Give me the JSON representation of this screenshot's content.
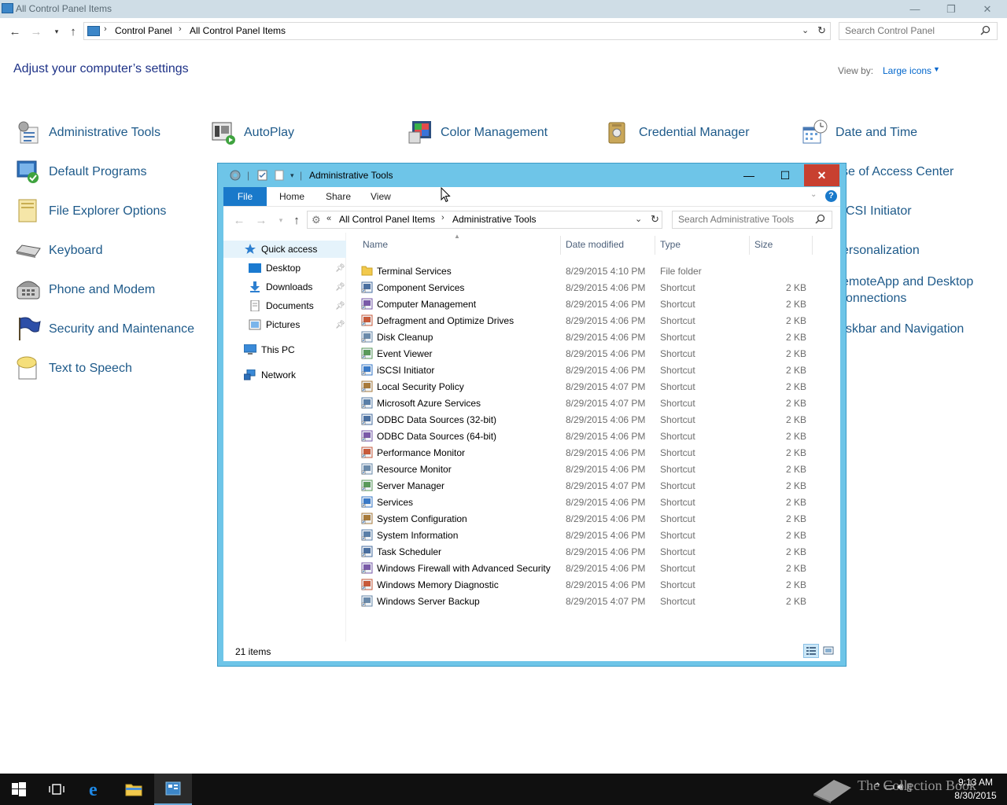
{
  "control_panel": {
    "window_title": "All Control Panel Items",
    "address": {
      "crumbs": [
        "Control Panel",
        "All Control Panel Items"
      ]
    },
    "search_placeholder": "Search Control Panel",
    "heading": "Adjust your computer’s settings",
    "view_by_label": "View by:",
    "view_by_value": "Large icons",
    "items": [
      {
        "label": "Administrative Tools",
        "icon": "admin-tools-icon"
      },
      {
        "label": "AutoPlay",
        "icon": "autoplay-icon"
      },
      {
        "label": "Color Management",
        "icon": "color-management-icon"
      },
      {
        "label": "Credential Manager",
        "icon": "credential-manager-icon"
      },
      {
        "label": "Date and Time",
        "icon": "date-time-icon"
      },
      {
        "label": "Default Programs",
        "icon": "default-programs-icon"
      },
      {
        "label": "se of Access Center",
        "icon": "ease-of-access-icon"
      },
      {
        "label": "File Explorer Options",
        "icon": "file-explorer-options-icon"
      },
      {
        "label": "CSI Initiator",
        "icon": "iscsi-icon"
      },
      {
        "label": "Keyboard",
        "icon": "keyboard-icon"
      },
      {
        "label": "ersonalization",
        "icon": "personalization-icon"
      },
      {
        "label": "Phone and Modem",
        "icon": "phone-modem-icon"
      },
      {
        "label": "emoteApp and Desktop",
        "label2": "onnections",
        "icon": "remoteapp-icon"
      },
      {
        "label": "Security and Maintenance",
        "icon": "security-maintenance-icon"
      },
      {
        "label": "skbar and Navigation",
        "icon": "taskbar-icon"
      },
      {
        "label": "Text to Speech",
        "icon": "text-to-speech-icon"
      }
    ]
  },
  "admin_tools": {
    "window_title": "Administrative Tools",
    "ribbon_tabs": [
      "File",
      "Home",
      "Share",
      "View"
    ],
    "address": {
      "prefix": "«",
      "crumbs": [
        "All Control Panel Items",
        "Administrative Tools"
      ]
    },
    "search_placeholder": "Search Administrative Tools",
    "nav_tree": [
      {
        "label": "Quick access",
        "icon": "star-icon",
        "pinned": false
      },
      {
        "label": "Desktop",
        "icon": "desktop-icon",
        "pinned": true
      },
      {
        "label": "Downloads",
        "icon": "download-icon",
        "pinned": true
      },
      {
        "label": "Documents",
        "icon": "documents-icon",
        "pinned": true
      },
      {
        "label": "Pictures",
        "icon": "pictures-icon",
        "pinned": true
      },
      {
        "label": "This PC",
        "icon": "computer-icon",
        "pinned": false
      },
      {
        "label": "Network",
        "icon": "network-icon",
        "pinned": false
      }
    ],
    "columns": [
      "Name",
      "Date modified",
      "Type",
      "Size"
    ],
    "files": [
      {
        "name": "Terminal Services",
        "date": "8/29/2015 4:10 PM",
        "type": "File folder",
        "size": ""
      },
      {
        "name": "Component Services",
        "date": "8/29/2015 4:06 PM",
        "type": "Shortcut",
        "size": "2 KB"
      },
      {
        "name": "Computer Management",
        "date": "8/29/2015 4:06 PM",
        "type": "Shortcut",
        "size": "2 KB"
      },
      {
        "name": "Defragment and Optimize Drives",
        "date": "8/29/2015 4:06 PM",
        "type": "Shortcut",
        "size": "2 KB"
      },
      {
        "name": "Disk Cleanup",
        "date": "8/29/2015 4:06 PM",
        "type": "Shortcut",
        "size": "2 KB"
      },
      {
        "name": "Event Viewer",
        "date": "8/29/2015 4:06 PM",
        "type": "Shortcut",
        "size": "2 KB"
      },
      {
        "name": "iSCSI Initiator",
        "date": "8/29/2015 4:06 PM",
        "type": "Shortcut",
        "size": "2 KB"
      },
      {
        "name": "Local Security Policy",
        "date": "8/29/2015 4:07 PM",
        "type": "Shortcut",
        "size": "2 KB"
      },
      {
        "name": "Microsoft Azure Services",
        "date": "8/29/2015 4:07 PM",
        "type": "Shortcut",
        "size": "2 KB"
      },
      {
        "name": "ODBC Data Sources (32-bit)",
        "date": "8/29/2015 4:06 PM",
        "type": "Shortcut",
        "size": "2 KB"
      },
      {
        "name": "ODBC Data Sources (64-bit)",
        "date": "8/29/2015 4:06 PM",
        "type": "Shortcut",
        "size": "2 KB"
      },
      {
        "name": "Performance Monitor",
        "date": "8/29/2015 4:06 PM",
        "type": "Shortcut",
        "size": "2 KB"
      },
      {
        "name": "Resource Monitor",
        "date": "8/29/2015 4:06 PM",
        "type": "Shortcut",
        "size": "2 KB"
      },
      {
        "name": "Server Manager",
        "date": "8/29/2015 4:07 PM",
        "type": "Shortcut",
        "size": "2 KB"
      },
      {
        "name": "Services",
        "date": "8/29/2015 4:06 PM",
        "type": "Shortcut",
        "size": "2 KB"
      },
      {
        "name": "System Configuration",
        "date": "8/29/2015 4:06 PM",
        "type": "Shortcut",
        "size": "2 KB"
      },
      {
        "name": "System Information",
        "date": "8/29/2015 4:06 PM",
        "type": "Shortcut",
        "size": "2 KB"
      },
      {
        "name": "Task Scheduler",
        "date": "8/29/2015 4:06 PM",
        "type": "Shortcut",
        "size": "2 KB"
      },
      {
        "name": "Windows Firewall with Advanced Security",
        "date": "8/29/2015 4:06 PM",
        "type": "Shortcut",
        "size": "2 KB"
      },
      {
        "name": "Windows Memory Diagnostic",
        "date": "8/29/2015 4:06 PM",
        "type": "Shortcut",
        "size": "2 KB"
      },
      {
        "name": "Windows Server Backup",
        "date": "8/29/2015 4:07 PM",
        "type": "Shortcut",
        "size": "2 KB"
      }
    ],
    "status_count": "21 items"
  },
  "taskbar": {
    "time": "9:13 AM",
    "date": "8/30/2015",
    "watermark": "The Collection Book"
  },
  "colors": {
    "accent": "#1979ca",
    "window_frame": "#6ec5e8",
    "close_red": "#c84030",
    "link_blue": "#1e5a8a",
    "heading_blue": "#1e3287"
  }
}
